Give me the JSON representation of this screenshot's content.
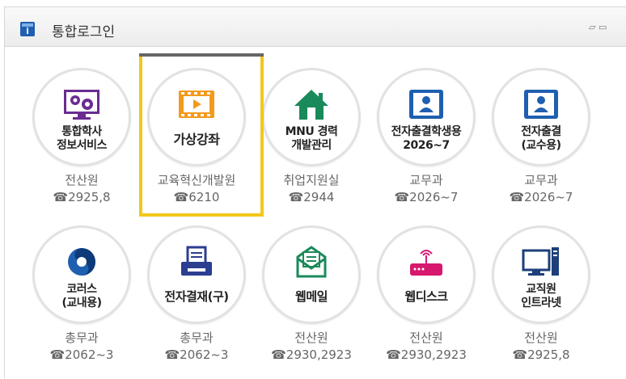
{
  "header": {
    "title": "통합로그인",
    "tools": "▱ ▭"
  },
  "colors": {
    "highlight": "#f2c71a",
    "accent": "#1f5fb0"
  },
  "tiles": [
    {
      "icon": "monitor-gears-icon",
      "label": "통합학사\n정보서비스",
      "dept": "전산원",
      "phone": "☎2925,8"
    },
    {
      "icon": "film-play-icon",
      "label": "가상강좌",
      "dept": "교육혁신개발원",
      "phone": "☎6210"
    },
    {
      "icon": "house-icon",
      "label": "MNU 경력\n개발관리",
      "dept": "취업지원실",
      "phone": "☎2944"
    },
    {
      "icon": "tablet-user-icon",
      "label": "전자출결학생용\n2026~7",
      "dept": "교무과",
      "phone": "☎2026~7"
    },
    {
      "icon": "tablet-user-icon",
      "label": "전자출결\n(교수용)",
      "dept": "교무과",
      "phone": "☎2026~7"
    },
    {
      "icon": "korus-logo-icon",
      "label": "코러스\n(교내용)",
      "dept": "총무과",
      "phone": "☎2062~3"
    },
    {
      "icon": "printer-doc-icon",
      "label": "전자결재(구)",
      "dept": "총무과",
      "phone": "☎2062~3"
    },
    {
      "icon": "envelope-icon",
      "label": "웹메일",
      "dept": "전산원",
      "phone": "☎2930,2923"
    },
    {
      "icon": "router-icon",
      "label": "웹디스크",
      "dept": "전산원",
      "phone": "☎2930,2923"
    },
    {
      "icon": "desktop-computer-icon",
      "label": "교직원\n인트라넷",
      "dept": "전산원",
      "phone": "☎2925,8"
    }
  ]
}
